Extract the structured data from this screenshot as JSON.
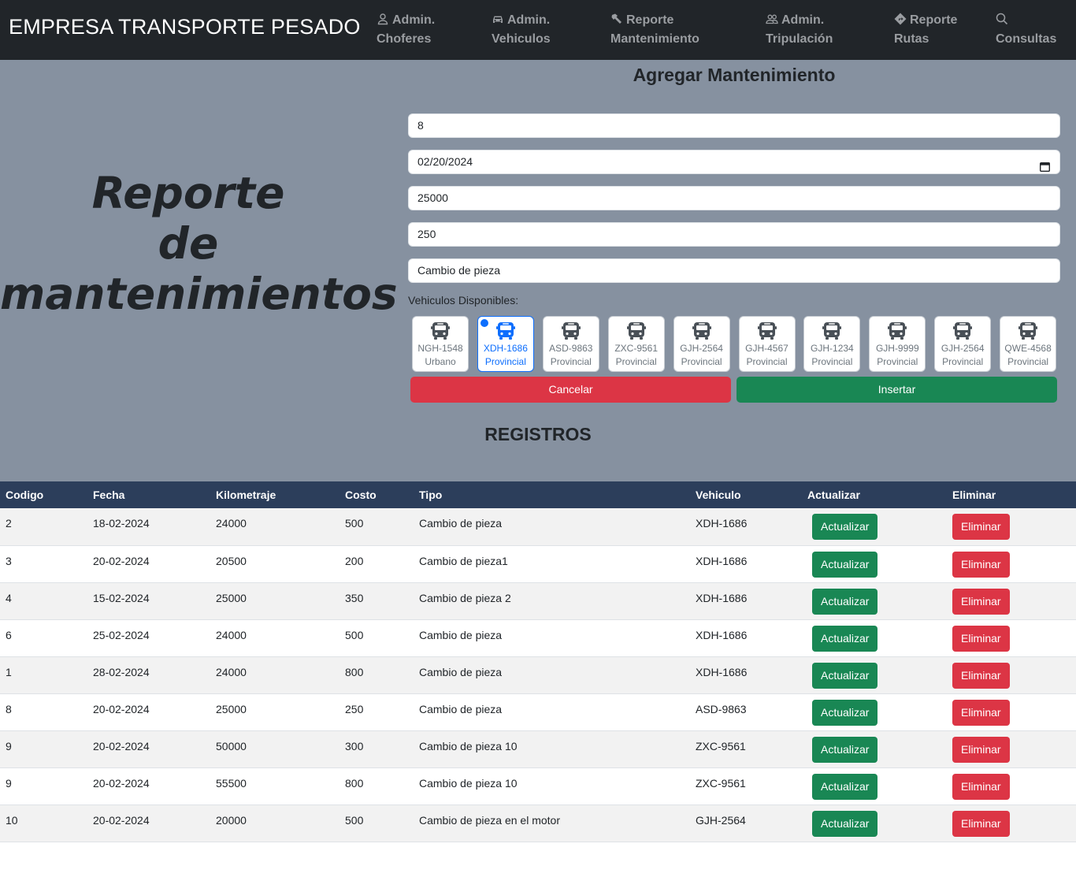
{
  "navbar": {
    "brand": "EMPRESA TRANSPORTE PESADO",
    "items": [
      {
        "line1": "Admin.",
        "line2": "Choferes",
        "icon": "person-icon"
      },
      {
        "line1": "Admin.",
        "line2": "Vehiculos",
        "icon": "car-icon"
      },
      {
        "line1": "Reporte",
        "line2": "Mantenimiento",
        "icon": "hammer-icon"
      },
      {
        "line1": "Admin.",
        "line2": "Tripulación",
        "icon": "people-icon"
      },
      {
        "line1": "Reporte",
        "line2": "Rutas",
        "icon": "signpost-icon"
      },
      {
        "line1": "Consultas",
        "line2": "",
        "icon": "search-icon"
      }
    ]
  },
  "sidebar": {
    "title_line1": "Reporte",
    "title_line2": "de",
    "title_line3": "mantenimientos"
  },
  "form": {
    "title": "Agregar Mantenimiento",
    "codigo": "8",
    "fecha": "02/20/2024",
    "kilometraje": "25000",
    "costo": "250",
    "tipo": "Cambio de pieza",
    "vehicles_label": "Vehiculos Disponibles:",
    "vehicles": [
      {
        "plate": "NGH-1548",
        "kind": "Urbano",
        "selected": false
      },
      {
        "plate": "XDH-1686",
        "kind": "Provincial",
        "selected": true
      },
      {
        "plate": "ASD-9863",
        "kind": "Provincial",
        "selected": false
      },
      {
        "plate": "ZXC-9561",
        "kind": "Provincial",
        "selected": false
      },
      {
        "plate": "GJH-2564",
        "kind": "Provincial",
        "selected": false
      },
      {
        "plate": "GJH-4567",
        "kind": "Provincial",
        "selected": false
      },
      {
        "plate": "GJH-1234",
        "kind": "Provincial",
        "selected": false
      },
      {
        "plate": "GJH-9999",
        "kind": "Provincial",
        "selected": false
      },
      {
        "plate": "GJH-2564",
        "kind": "Provincial",
        "selected": false
      },
      {
        "plate": "QWE-4568",
        "kind": "Provincial",
        "selected": false
      }
    ],
    "cancel_label": "Cancelar",
    "insert_label": "Insertar"
  },
  "registros": {
    "title": "REGISTROS",
    "columns": [
      "Codigo",
      "Fecha",
      "Kilometraje",
      "Costo",
      "Tipo",
      "Vehiculo",
      "Actualizar",
      "Eliminar"
    ],
    "update_label": "Actualizar",
    "delete_label": "Eliminar",
    "rows": [
      {
        "codigo": "2",
        "fecha": "18-02-2024",
        "km": "24000",
        "costo": "500",
        "tipo": "Cambio de pieza",
        "vehiculo": "XDH-1686"
      },
      {
        "codigo": "3",
        "fecha": "20-02-2024",
        "km": "20500",
        "costo": "200",
        "tipo": "Cambio de pieza1",
        "vehiculo": "XDH-1686"
      },
      {
        "codigo": "4",
        "fecha": "15-02-2024",
        "km": "25000",
        "costo": "350",
        "tipo": "Cambio de pieza 2",
        "vehiculo": "XDH-1686"
      },
      {
        "codigo": "6",
        "fecha": "25-02-2024",
        "km": "24000",
        "costo": "500",
        "tipo": "Cambio de pieza",
        "vehiculo": "XDH-1686"
      },
      {
        "codigo": "1",
        "fecha": "28-02-2024",
        "km": "24000",
        "costo": "800",
        "tipo": "Cambio de pieza",
        "vehiculo": "XDH-1686"
      },
      {
        "codigo": "8",
        "fecha": "20-02-2024",
        "km": "25000",
        "costo": "250",
        "tipo": "Cambio de pieza",
        "vehiculo": "ASD-9863"
      },
      {
        "codigo": "9",
        "fecha": "20-02-2024",
        "km": "50000",
        "costo": "300",
        "tipo": "Cambio de pieza 10",
        "vehiculo": "ZXC-9561"
      },
      {
        "codigo": "9",
        "fecha": "20-02-2024",
        "km": "55500",
        "costo": "800",
        "tipo": "Cambio de pieza 10",
        "vehiculo": "ZXC-9561"
      },
      {
        "codigo": "10",
        "fecha": "20-02-2024",
        "km": "20000",
        "costo": "500",
        "tipo": "Cambio de pieza en el motor",
        "vehiculo": "GJH-2564"
      }
    ]
  },
  "colors": {
    "navbar": "#212529",
    "hero": "#8691a0",
    "table_header": "#2c3e5b",
    "success": "#198754",
    "danger": "#dc3545",
    "primary": "#0d6efd"
  }
}
